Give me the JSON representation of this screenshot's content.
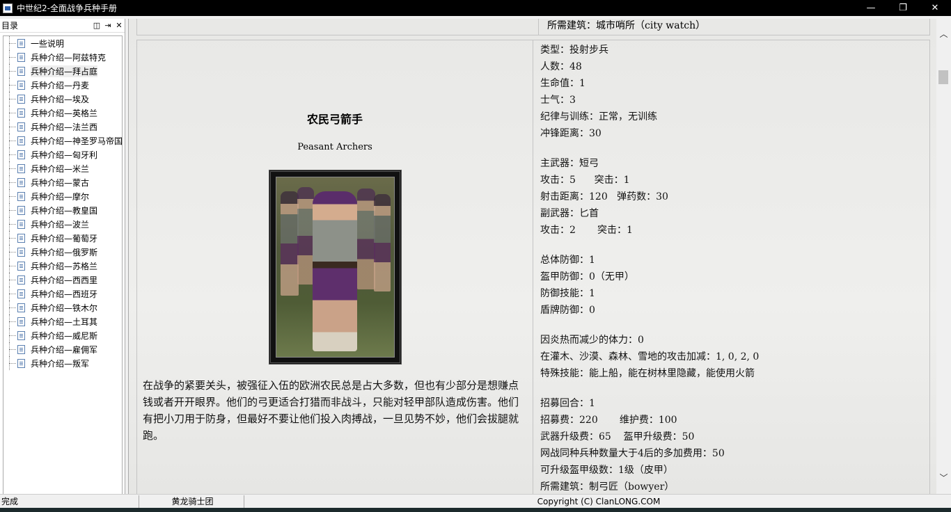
{
  "window": {
    "title": "中世纪2-全面战争兵种手册",
    "min": "—",
    "restore": "❐",
    "close": "✕"
  },
  "toc": {
    "title": "目录",
    "buttons": [
      "◫",
      "⇥",
      "✕"
    ],
    "selected_index": 2,
    "items": [
      "一些说明",
      "兵种介绍—阿兹特克",
      "兵种介绍—拜占庭",
      "兵种介绍—丹麦",
      "兵种介绍—埃及",
      "兵种介绍—英格兰",
      "兵种介绍—法兰西",
      "兵种介绍—神圣罗马帝国",
      "兵种介绍—匈牙利",
      "兵种介绍—米兰",
      "兵种介绍—蒙古",
      "兵种介绍—摩尔",
      "兵种介绍—教皇国",
      "兵种介绍—波兰",
      "兵种介绍—葡萄牙",
      "兵种介绍—俄罗斯",
      "兵种介绍—苏格兰",
      "兵种介绍—西西里",
      "兵种介绍—西班牙",
      "兵种介绍—铁木尔",
      "兵种介绍—土耳其",
      "兵种介绍—威尼斯",
      "兵种介绍—雇佣军",
      "兵种介绍—叛军"
    ]
  },
  "content": {
    "top_row_text": "所需建筑：城市哨所（city watch）",
    "unit": {
      "name_cn": "农民弓箭手",
      "name_en": "Peasant Archers",
      "description": "在战争的紧要关头，被强征入伍的欧洲农民总是占大多数，但也有少部分是想赚点钱或者开开眼界。他们的弓更适合打猎而非战斗，只能对轻甲部队造成伤害。他们有把小刀用于防身，但最好不要让他们投入肉搏战，一旦见势不妙，他们会拔腿就跑。"
    },
    "stats": {
      "group1": [
        "类型：投射步兵",
        "人数：48",
        "生命值：1",
        "士气：3",
        "纪律与训练：正常，无训练",
        "冲锋距离：30"
      ],
      "group2": [
        "主武器：短弓",
        "攻击：5      突击：1",
        "射击距离：120   弹药数：30",
        "副武器：匕首",
        "攻击：2       突击：1"
      ],
      "group3": [
        "总体防御：1",
        "盔甲防御：0（无甲）",
        "防御技能：1",
        "盾牌防御：0"
      ],
      "group4": [
        "因炎热而减少的体力：0",
        "在灌木、沙漠、森林、雪地的攻击加减：1, 0, 2, 0",
        "特殊技能：能上船，能在树林里隐藏，能使用火箭"
      ],
      "group5": [
        "招募回合：1",
        "招募费：220       维护费：100",
        "武器升级费：65    盔甲升级费：50",
        "网战同种兵种数量大于4后的多加费用：50",
        "可升级盔甲级数：1级（皮甲）",
        "所需建筑：制弓匠（bowyer）"
      ]
    }
  },
  "statusbar": {
    "status": "完成",
    "author": "黄龙骑士团",
    "copyright": "Copyright (C) ClanLONG.COM"
  },
  "scroll": {
    "up": "︿",
    "down": "﹀",
    "left": "‹",
    "right": "›"
  }
}
